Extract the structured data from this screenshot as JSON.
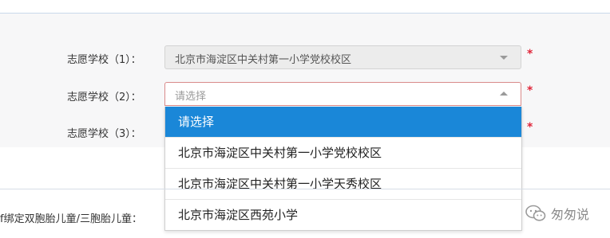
{
  "form": {
    "fields": [
      {
        "label": "志愿学校（1）：",
        "value": "北京市海淀区中关村第一小学党校校区",
        "state": "disabled",
        "required_mark": "*"
      },
      {
        "label": "志愿学校（2）：",
        "value": "请选择",
        "state": "open",
        "required_mark": "*"
      },
      {
        "label": "志愿学校（3）：",
        "required_mark": "*"
      }
    ],
    "dropdown": {
      "options": [
        {
          "label": "请选择",
          "selected": true
        },
        {
          "label": "北京市海淀区中关村第一小学党校校区",
          "selected": false
        },
        {
          "label": "北京市海淀区中关村第一小学天秀校区",
          "selected": false
        },
        {
          "label": "北京市海淀区西苑小学",
          "selected": false
        }
      ]
    },
    "bottom_label": "f绑定双胞胎儿童/三胞胎儿童："
  },
  "watermark": {
    "icon": "wechat-icon",
    "text": "匆匆说"
  },
  "colors": {
    "required": "#e0263a",
    "selected_option": "#1a87d8",
    "panel_background": "#f7f7f8"
  }
}
